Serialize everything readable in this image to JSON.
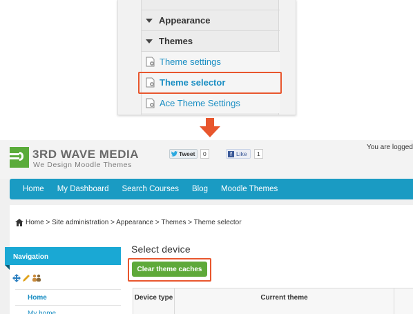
{
  "admin_menu": {
    "items": [
      {
        "label": "Appearance",
        "kind": "header"
      },
      {
        "label": "Themes",
        "kind": "header"
      },
      {
        "label": "Theme settings",
        "kind": "link"
      },
      {
        "label": "Theme selector",
        "kind": "link",
        "highlighted": true
      },
      {
        "label": "Ace Theme Settings",
        "kind": "link"
      }
    ]
  },
  "site": {
    "logo": {
      "title": "3RD WAVE MEDIA",
      "subtitle": "We Design Moodle Themes"
    },
    "social": {
      "tweet_label": "Tweet",
      "tweet_count": "0",
      "like_label": "Like",
      "like_count": "1"
    },
    "logged_in_text": "You are logged i",
    "nav": [
      "Home",
      "My Dashboard",
      "Search Courses",
      "Blog",
      "Moodle Themes"
    ],
    "breadcrumb": "Home > Site administration > Appearance > Themes > Theme selector",
    "navigation_block": {
      "title": "Navigation",
      "items": [
        "Home",
        "My home"
      ]
    },
    "main": {
      "heading": "Select device",
      "clear_button": "Clear theme caches",
      "table_headers": [
        "Device type",
        "Current theme"
      ]
    }
  },
  "colors": {
    "accent_blue": "#1a9bc3",
    "highlight_orange": "#e8562d",
    "button_green": "#5ea93a",
    "link_blue": "#1a8ec3"
  }
}
